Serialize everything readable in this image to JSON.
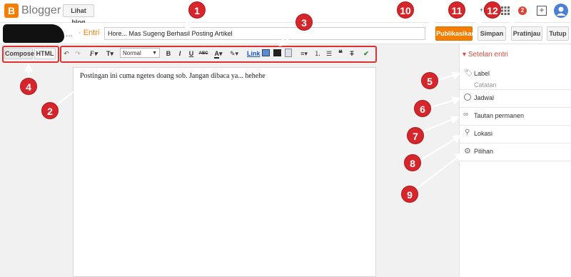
{
  "app": {
    "logo_letter": "B",
    "name": "Blogger",
    "view_blog": "Lihat blog"
  },
  "header": {
    "breadcrumb_ellipsis": "...",
    "breadcrumb_entry": "· Entri",
    "title_value": "Hore... Mas Sugeng Berhasil Posting Artikel",
    "publish": "Publikasikan",
    "save": "Simpan",
    "preview": "Pratinjau",
    "close": "Tutup",
    "user_partial": "+Ma",
    "notification_count": "2"
  },
  "mode_tabs": {
    "compose": "Compose",
    "html": "HTML"
  },
  "toolbar": {
    "undo": "↶",
    "redo": "↷",
    "font": "F",
    "font_size": "T",
    "format": "Normal",
    "bold": "B",
    "italic": "I",
    "underline": "U",
    "strike": "ABC",
    "text_color": "A",
    "link": "Link",
    "quote": "❝",
    "clear_format": "T"
  },
  "editor": {
    "content": "Postingan ini cuma ngetes doang sob. Jangan dibaca ya... hehehe"
  },
  "sidebar": {
    "title": "Setelan entri",
    "items": [
      {
        "label": "Label",
        "sub": "Catatan",
        "icon": "tag-icon"
      },
      {
        "label": "Jadwal",
        "icon": "clock-icon"
      },
      {
        "label": "Tautan permanen",
        "icon": "link-icon"
      },
      {
        "label": "Lokasi",
        "icon": "location-icon"
      },
      {
        "label": "Pilihan",
        "icon": "gear-icon"
      }
    ]
  },
  "annotations": [
    "1",
    "2",
    "3",
    "4",
    "5",
    "6",
    "7",
    "8",
    "9",
    "10",
    "11",
    "12"
  ],
  "colors": {
    "accent": "#f57d00",
    "marker": "#d6262b",
    "box": "#e03030"
  }
}
